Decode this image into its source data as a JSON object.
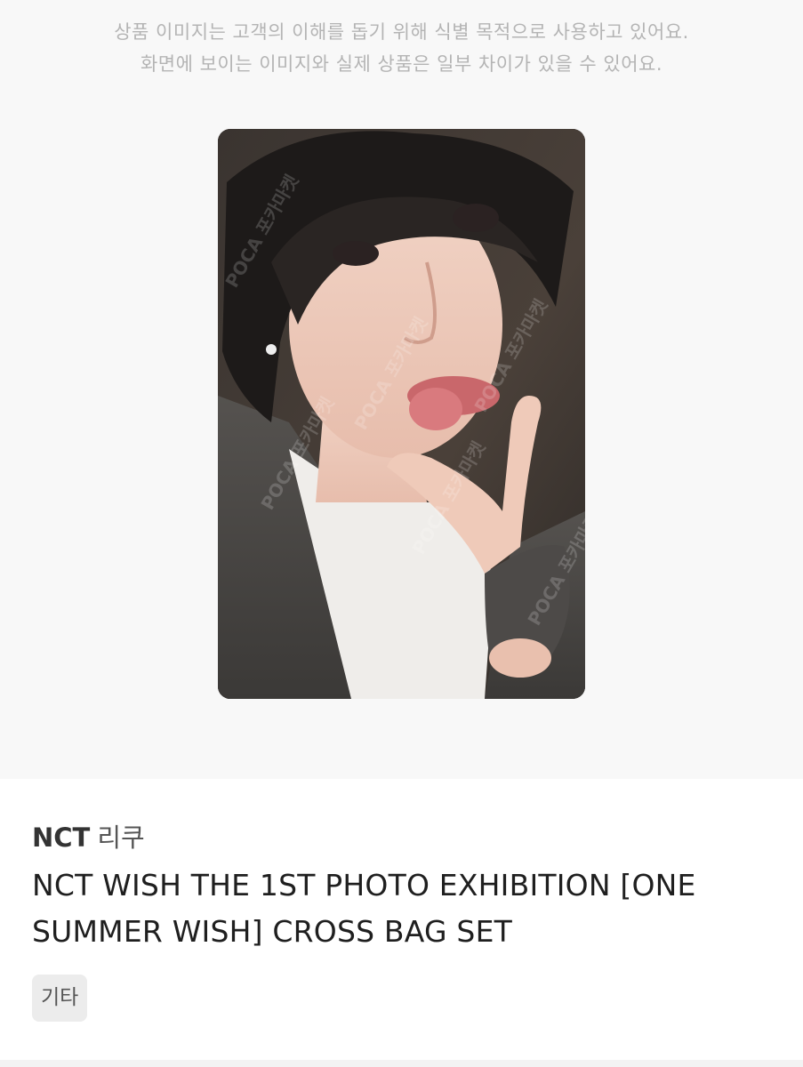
{
  "notice": {
    "line1": "상품 이미지는 고객의 이해를 돕기 위해 식별 목적으로 사용하고 있어요.",
    "line2": "화면에 보이는 이미지와 실제 상품은 일부 차이가 있을 수 있어요."
  },
  "photo": {
    "watermark": "POCA 포카마켓"
  },
  "product": {
    "brand": "NCT",
    "member": "리쿠",
    "title_line1": "NCT WISH THE 1ST PHOTO EXHIBITION [ONE",
    "title_line2": "SUMMER WISH] CROSS BAG SET",
    "tag": "기타"
  }
}
